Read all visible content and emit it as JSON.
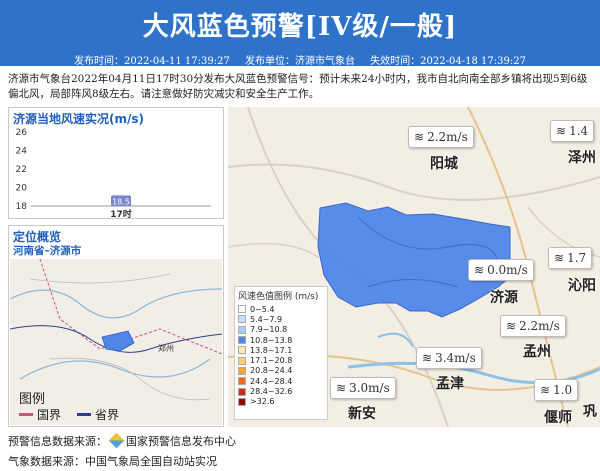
{
  "header": {
    "title": "大风蓝色预警[IV级/一般]",
    "publish_time_label": "发布时间：2022-04-11 17:39:27",
    "publisher_label": "发布单位：济源市气象台",
    "expire_label": "失效时间：2022-04-18 17:39:27"
  },
  "description": "济源市气象台2022年04月11日17时30分发布大风蓝色预警信号：预计未来24小时内，我市自北向南全部乡镇将出现5到6级偏北风，局部阵风8级左右。请注意做好防灾减灾和安全生产工作。",
  "wind_panel": {
    "title": "济源当地风速实况(m/s)"
  },
  "chart_data": {
    "type": "bar",
    "categories": [
      "17时"
    ],
    "values": [
      18.5
    ],
    "data_labels": [
      "18.5"
    ],
    "yticks": [
      "18",
      "20",
      "22",
      "24",
      "26"
    ],
    "ylim": [
      18,
      26
    ],
    "grid": false
  },
  "location_panel": {
    "title": "定位概览",
    "region": "河南省–济源市"
  },
  "location_legend": {
    "title": "图例",
    "items": [
      {
        "label": "国界",
        "color": "#c9567a"
      },
      {
        "label": "省界",
        "color": "#2c3e90"
      }
    ]
  },
  "mini_map": {
    "city_label": "郑州"
  },
  "wind_legend": {
    "title": "风速色值图例 (m/s)",
    "ranges": [
      {
        "label": "0~5.4",
        "color": "#ffffff"
      },
      {
        "label": "5.4~7.9",
        "color": "#c8e0f8"
      },
      {
        "label": "7.9~10.8",
        "color": "#a8cdf3"
      },
      {
        "label": "10.8~13.8",
        "color": "#4f86e8"
      },
      {
        "label": "13.8~17.1",
        "color": "#fde8b0"
      },
      {
        "label": "17.1~20.8",
        "color": "#fbd06a"
      },
      {
        "label": "20.8~24.4",
        "color": "#f7a33b"
      },
      {
        "label": "24.4~28.4",
        "color": "#ef6a1e"
      },
      {
        "label": "28.4~32.6",
        "color": "#d02a15"
      },
      {
        "label": ">32.6",
        "color": "#8b0c0c"
      }
    ]
  },
  "warning_area_color": "#4f86e8",
  "map": {
    "cities": [
      "阳城",
      "泽州",
      "沁阳",
      "济源",
      "孟州",
      "孟津",
      "新安",
      "偃师",
      "巩"
    ],
    "stations": [
      "2.2m/s",
      "1.4",
      "0.0m/s",
      "1.7",
      "2.2m/s",
      "3.4m/s",
      "3.0m/s",
      "1.0"
    ]
  },
  "footer": {
    "warning_source": "预警信息数据来源：",
    "warning_source_name": "国家预警信息发布中心",
    "weather_source": "气象数据来源：中国气象局全国自动站实况"
  }
}
